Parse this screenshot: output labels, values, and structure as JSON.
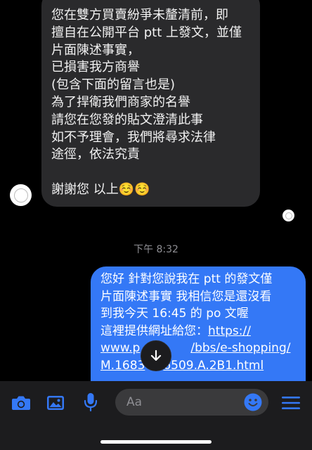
{
  "incoming_message": {
    "lines": [
      "您在雙方買賣紛爭未釐清前，即",
      "擅自在公開平台 ptt 上發文，並僅",
      "片面陳述事實，",
      "已損害我方商譽",
      "(包含下面的留言也是)",
      "為了捍衛我們商家的名譽",
      "請您在您發的貼文澄清此事",
      "如不予理會，我們將尋求法律",
      "途徑，依法究責",
      "",
      "謝謝您 以上☺️☺️"
    ]
  },
  "timestamp": "下午 8:32",
  "outgoing_message": {
    "lines": [
      "您好 針對您說我在 ptt 的發文僅",
      "片面陳述事實 我相信您是還沒看",
      "到我今天 16:45 的 po 文喔",
      "這裡提供網址給您："
    ],
    "link_start": "https://",
    "link_line2_a": "www.p",
    "link_line2_b": "/bbs/e-shopping/",
    "link_line3_a": "M.1683",
    "link_line3_b": "6509.A.2B1.html"
  },
  "composer": {
    "placeholder": "Aa"
  },
  "icons": {
    "camera": "camera-icon",
    "photo": "photo-icon",
    "mic": "microphone-icon",
    "emoji": "emoji-icon",
    "menu": "menu-icon",
    "scroll": "arrow-down-icon"
  },
  "colors": {
    "accent": "#3478f6",
    "incoming_bubble": "#2a2a2c",
    "toolbar": "#1c1c1e",
    "input": "#3a3a3c"
  }
}
